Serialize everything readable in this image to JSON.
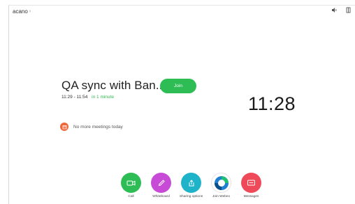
{
  "header": {
    "title": "acano",
    "chevron": "›",
    "icons": [
      "volume-icon",
      "panel-icon"
    ]
  },
  "meeting": {
    "title": "QA sync with Ban...",
    "time_range": "11:29 - 11:54",
    "starts_in": "in 1 minute",
    "join_label": "Join"
  },
  "clock": {
    "time": "11:28"
  },
  "agenda": {
    "no_more_label": "No more meetings today"
  },
  "dock": {
    "items": [
      {
        "label": "Call",
        "icon": "camera-icon",
        "color": "#2ebd55"
      },
      {
        "label": "Whiteboard",
        "icon": "pencil-icon",
        "color": "#c84bd8"
      },
      {
        "label": "Sharing options",
        "icon": "share-icon",
        "color": "#1fb3c9"
      },
      {
        "label": "Join Webex",
        "icon": "webex-icon",
        "color": "#1f7fd0"
      },
      {
        "label": "Messages",
        "icon": "message-icon",
        "color": "#ef4a5a"
      }
    ]
  },
  "colors": {
    "accent_green": "#2ebd55",
    "soon_green": "#2fb84f",
    "calendar_orange": "#f0663a"
  }
}
